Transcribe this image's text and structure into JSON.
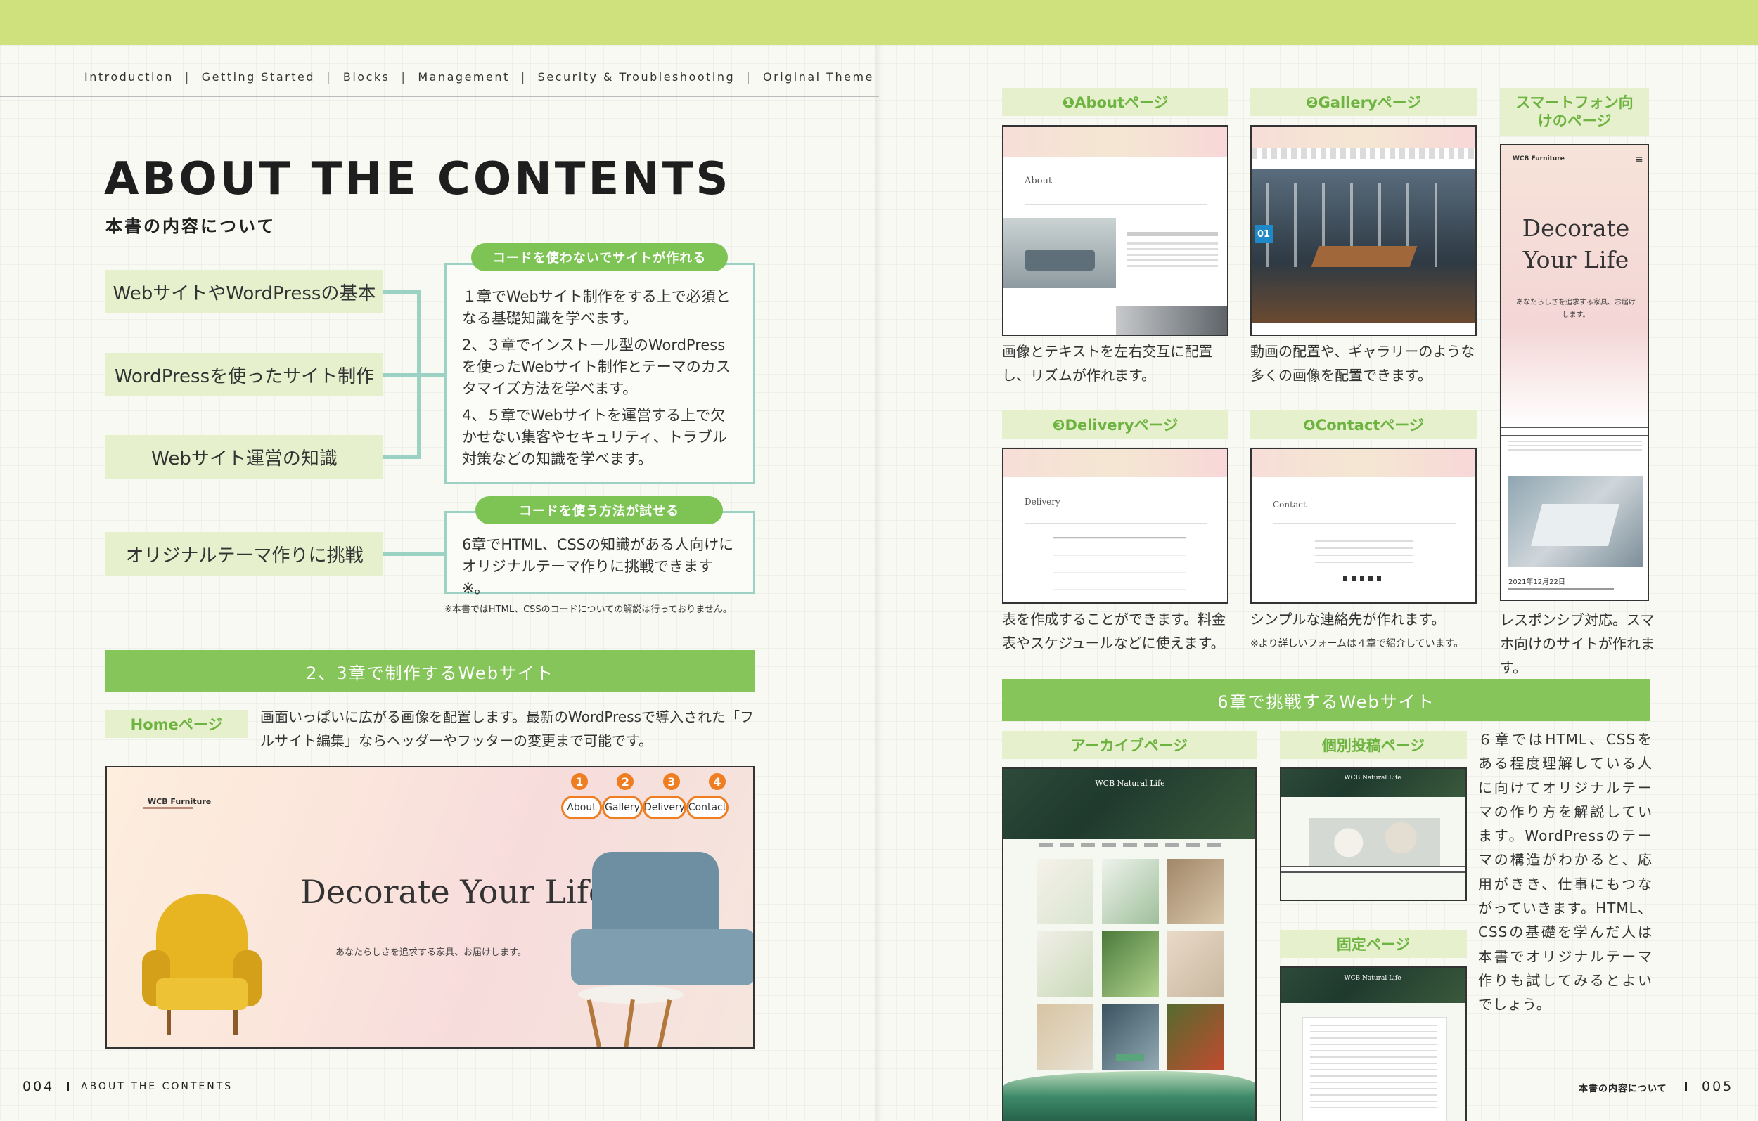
{
  "nav": {
    "items": [
      "Introduction",
      "Getting Started",
      "Blocks",
      "Management",
      "Security & Troubleshooting",
      "Original Theme"
    ],
    "separator": "|"
  },
  "header": {
    "title": "ABOUT THE CONTENTS",
    "subtitle": "本書の内容について"
  },
  "overview": {
    "labels": [
      "WebサイトやWordPressの基本",
      "WordPressを使ったサイト制作",
      "Webサイト運営の知識",
      "オリジナルテーマ作りに挑戦"
    ],
    "pill1": "コードを使わないでサイトが作れる",
    "box1": [
      "１章でWebサイト制作をする上で必須となる基礎知識を学べます。",
      "2、３章でインストール型のWordPressを使ったWebサイト制作とテーマのカスタマイズ方法を学べます。",
      "4、５章でWebサイトを運営する上で欠かせない集客やセキュリティ、トラブル対策などの知識を学べます。"
    ],
    "pill2": "コードを使う方法が試せる",
    "box2": "6章でHTML、CSSの知識がある人向けにオリジナルテーマ作りに挑戦できます※。",
    "note": "※本書ではHTML、CSSのコードについての解説は行っておりません。"
  },
  "section23": {
    "bar": "2、3章で制作するWebサイト",
    "home_tag": "Homeページ",
    "home_desc": "画面いっぱいに広がる画像を配置します。最新のWordPressで導入された「フルサイト編集」ならヘッダーやフッターの変更まで可能です。",
    "hero_logo": "WCB Furniture",
    "hero_title": "Decorate Your Life",
    "hero_sub": "あなたらしさを追求する家具、お届けします。",
    "hero_nav": [
      {
        "num": "1",
        "label": "About"
      },
      {
        "num": "2",
        "label": "Gallery"
      },
      {
        "num": "3",
        "label": "Delivery"
      },
      {
        "num": "4",
        "label": "Contact"
      }
    ]
  },
  "pages": {
    "about_tag": "❶Aboutページ",
    "about_title": "About",
    "about_caption": "画像とテキストを左右交互に配置し、リズムが作れます。",
    "gallery_tag": "❷Galleryページ",
    "gallery_num": "01",
    "gallery_caption": "動画の配置や、ギャラリーのような多くの画像を配置できます。",
    "delivery_tag": "❸Deliveryページ",
    "delivery_title": "Delivery",
    "delivery_caption": "表を作成することができます。料金表やスケジュールなどに使えます。",
    "contact_tag": "❹Contactページ",
    "contact_title": "Contact",
    "contact_caption": "シンプルな連絡先が作れます。",
    "contact_note": "※より詳しいフォームは４章で紹介しています。",
    "smartphone_tag": "スマートフォン向けのページ",
    "sp_logo": "WCB Furniture",
    "sp_title": "Decorate Your Life",
    "sp_sub": "あなたらしさを追求する家具、お届けします。",
    "sp_date": "2021年12月22日",
    "sp_caption": "レスポンシブ対応。スマホ向けのサイトが作れます。"
  },
  "section6": {
    "bar": "6章で挑戦するWebサイト",
    "archive_tag": "アーカイブページ",
    "single_tag": "個別投稿ページ",
    "fixed_tag": "固定ページ",
    "logo": "WCB Natural Life",
    "desc": "６章ではHTML、CSSをある程度理解している人に向けてオリジナルテーマの作り方を解説しています。WordPressのテーマの構造がわかると、応用がきき、仕事にもつながっていきます。HTML、CSSの基礎を学んだ人は本書でオリジナルテーマ作りも試してみるとよいでしょう。"
  },
  "footer": {
    "left_page": "004",
    "left_label": "ABOUT THE CONTENTS",
    "right_label": "本書の内容について",
    "right_page": "005"
  },
  "colors": {
    "band": "#cee17c",
    "green": "#86c55a",
    "teal": "#9bd2c3",
    "orange": "#ef7d22"
  }
}
